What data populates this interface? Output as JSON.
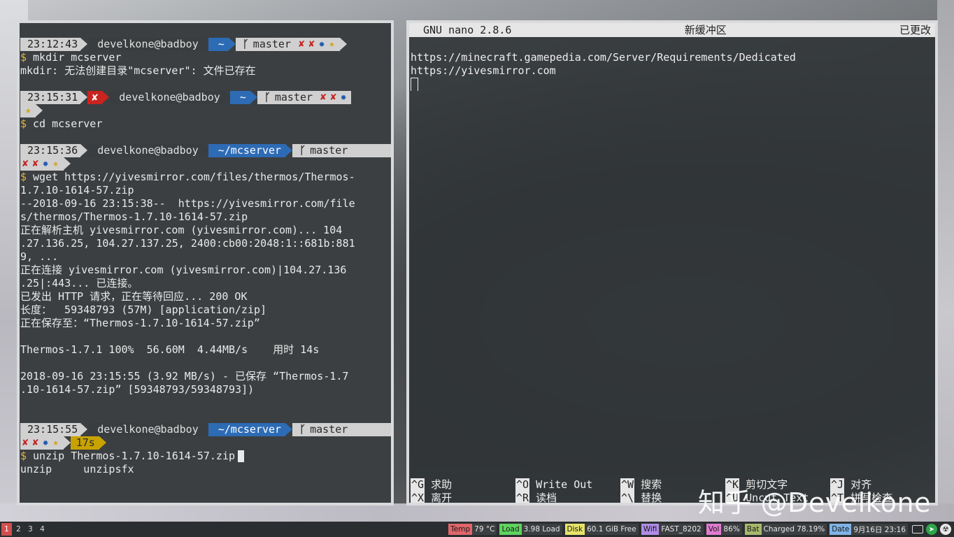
{
  "left_terminal": {
    "prompts": {
      "p1": {
        "time": "23:12:43",
        "user": "develkone@badboy",
        "dir": "~",
        "branch": "master"
      },
      "p2": {
        "time": "23:15:31",
        "err": "✘",
        "user": "develkone@badboy",
        "dir": "~",
        "branch": "master"
      },
      "p3": {
        "time": "23:15:36",
        "user": "develkone@badboy",
        "dir": "~/mcserver",
        "branch": "master"
      },
      "p4": {
        "time": "23:15:55",
        "user": "develkone@badboy",
        "dir": "~/mcserver",
        "branch": "master",
        "duration": "17s"
      }
    },
    "glyphs": {
      "x": "✘",
      "dot": "✹",
      "star": "★",
      "branch": "ᚴ",
      "dollar": "$"
    },
    "lines": {
      "cmd1": "mkdir mcserver",
      "out1": "mkdir: 无法创建目录\"mcserver\": 文件已存在",
      "cmd2": "cd mcserver",
      "cmd3a": "wget https://yivesmirror.com/files/thermos/Thermos-",
      "cmd3b": "1.7.10-1614-57.zip",
      "w1": "--2018-09-16 23:15:38--  https://yivesmirror.com/file",
      "w2": "s/thermos/Thermos-1.7.10-1614-57.zip",
      "w3": "正在解析主机 yivesmirror.com (yivesmirror.com)... 104",
      "w4": ".27.136.25, 104.27.137.25, 2400:cb00:2048:1::681b:881",
      "w5": "9, ...",
      "w6": "正在连接 yivesmirror.com (yivesmirror.com)|104.27.136",
      "w7": ".25|:443... 已连接。",
      "w8": "已发出 HTTP 请求，正在等待回应... 200 OK",
      "w9": "长度：  59348793 (57M) [application/zip]",
      "w10": "正在保存至：“Thermos-1.7.10-1614-57.zip”",
      "w11": "Thermos-1.7.1 100%  56.60M  4.44MB/s    用时 14s",
      "w12": "2018-09-16 23:15:55 (3.92 MB/s) - 已保存 “Thermos-1.7",
      "w13": ".10-1614-57.zip” [59348793/59348793])",
      "cmd4": "unzip Thermos-1.7.10-1614-57.zip",
      "comp": "unzip     unzipsfx"
    }
  },
  "nano": {
    "version": "GNU nano 2.8.6",
    "buffer": "新缓冲区",
    "state": "已更改",
    "lines": [
      "https://minecraft.gamepedia.com/Server/Requirements/Dedicated",
      "https://yivesmirror.com"
    ],
    "shortcuts_row1": [
      {
        "key": "^G",
        "label": "求助"
      },
      {
        "key": "^O",
        "label": "Write Out"
      },
      {
        "key": "^W",
        "label": "搜索"
      },
      {
        "key": "^K",
        "label": "剪切文字"
      },
      {
        "key": "^J",
        "label": "对齐"
      }
    ],
    "shortcuts_row2": [
      {
        "key": "^X",
        "label": "离开"
      },
      {
        "key": "^R",
        "label": "读档"
      },
      {
        "key": "^\\",
        "label": "替换"
      },
      {
        "key": "^U",
        "label": "Uncut Text"
      },
      {
        "key": "^T",
        "label": "拼写检查"
      }
    ]
  },
  "watermark": "知乎 @Develkone",
  "taskbar": {
    "workspaces": [
      "1",
      "2",
      "3",
      "4"
    ],
    "active_workspace": "1",
    "modules": [
      {
        "label": "Temp",
        "value": "79 °C",
        "color": "#e0666b"
      },
      {
        "label": "Load",
        "value": "3.98 Load",
        "color": "#5fd35f"
      },
      {
        "label": "Disk",
        "value": "60.1 GiB Free",
        "color": "#e6e36a"
      },
      {
        "label": "Wifi",
        "value": "FAST_8202",
        "color": "#b08de6"
      },
      {
        "label": "Vol",
        "value": "86%",
        "color": "#e07bd0"
      },
      {
        "label": "Bat",
        "value": "Charged 78.19%",
        "color": "#a7b86c"
      },
      {
        "label": "Date",
        "value": "9月16日 23:16",
        "color": "#7fb3e6"
      }
    ],
    "tray_icons": [
      "keyboard-icon",
      "telegram-icon",
      "radiation-icon"
    ]
  }
}
